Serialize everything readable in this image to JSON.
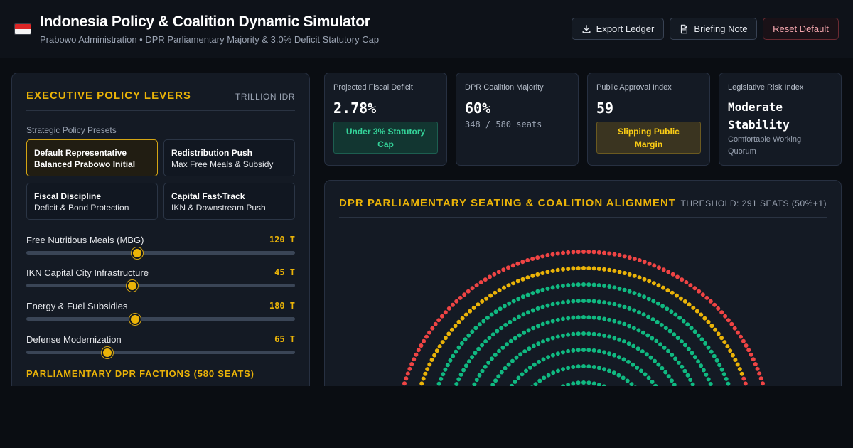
{
  "header": {
    "title": "Indonesia Policy & Coalition Dynamic Simulator",
    "subtitle": "Prabowo Administration • DPR Parliamentary Majority & 3.0% Deficit Statutory Cap",
    "buttons": {
      "export": "Export Ledger",
      "briefing": "Briefing Note",
      "reset": "Reset Default"
    },
    "icons": {
      "flag": "indonesia-flag-icon",
      "export": "download-icon",
      "briefing": "document-icon"
    }
  },
  "levers_panel": {
    "title": "EXECUTIVE POLICY LEVERS",
    "unit": "TRILLION IDR",
    "presets_label": "Strategic Policy Presets",
    "presets": [
      {
        "name": "Default Representative",
        "desc": "Balanced Prabowo Initial",
        "active": true
      },
      {
        "name": "Redistribution Push",
        "desc": "Max Free Meals & Subsidy",
        "active": false
      },
      {
        "name": "Fiscal Discipline",
        "desc": "Deficit & Bond Protection",
        "active": false
      },
      {
        "name": "Capital Fast-Track",
        "desc": "IKN & Downstream Push",
        "active": false
      }
    ],
    "levers": [
      {
        "label": "Free Nutritious Meals (MBG)",
        "value": "120 T",
        "level": 0.413
      },
      {
        "label": "IKN Capital City Infrastructure",
        "value": "45 T",
        "level": 0.394
      },
      {
        "label": "Energy & Fuel Subsidies",
        "value": "180 T",
        "level": 0.405
      },
      {
        "label": "Defense Modernization",
        "value": "65 T",
        "level": 0.302
      }
    ],
    "factions_title": "PARLIAMENTARY DPR FACTIONS (580 SEATS)"
  },
  "kpis": [
    {
      "label": "Projected Fiscal Deficit",
      "value": "2.78%",
      "badge": "Under 3% Statutory Cap",
      "badge_color": "#34d399"
    },
    {
      "label": "DPR Coalition Majority",
      "value": "60%",
      "sub": "348 / 580 seats"
    },
    {
      "label": "Public Approval Index",
      "value": "59",
      "badge": "Slipping Public Margin",
      "badge_color": "#facc15"
    },
    {
      "label": "Legislative Risk Index",
      "value": "Moderate Stability",
      "sub": "Comfortable Working Quorum"
    }
  ],
  "parliament": {
    "title": "DPR PARLIAMENTARY SEATING & COALITION ALIGNMENT",
    "threshold": "THRESHOLD: 291 SEATS (50%+1)",
    "colors": {
      "coalition": "#10b981",
      "swing": "#eab308",
      "opposition": "#ef4444"
    }
  }
}
